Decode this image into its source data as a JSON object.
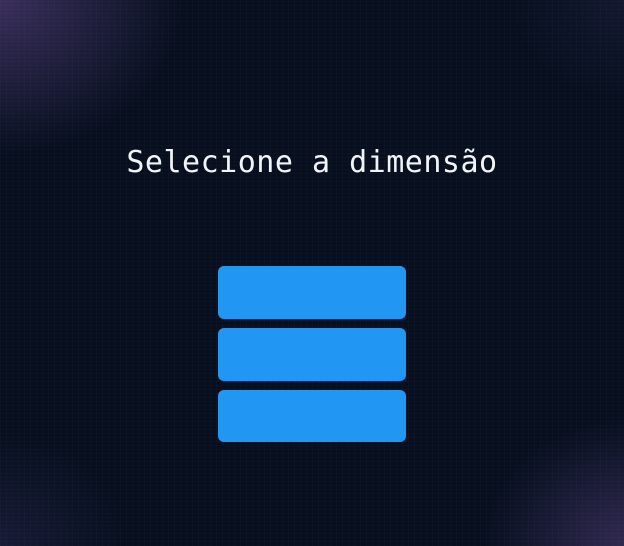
{
  "screen": {
    "title": "Selecione a dimensão"
  },
  "options": [
    {
      "label": ""
    },
    {
      "label": ""
    },
    {
      "label": ""
    }
  ],
  "colors": {
    "background": "#070f1f",
    "accent_glow": "#62488c",
    "button": "#2196f3",
    "title_text": "#f2f4f8"
  }
}
